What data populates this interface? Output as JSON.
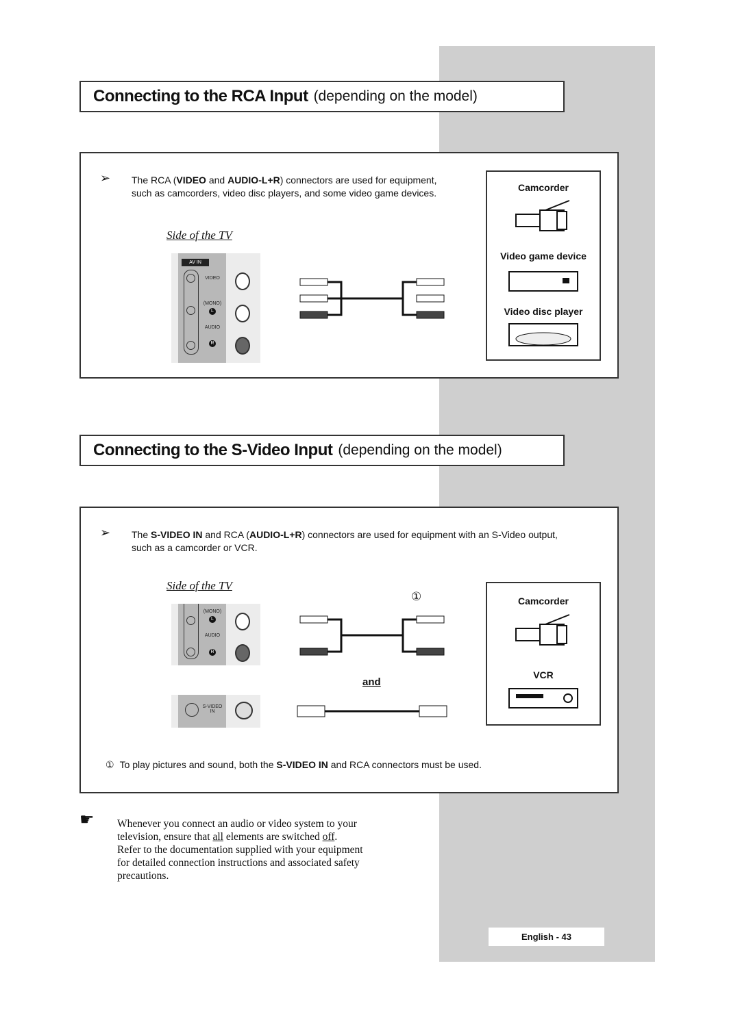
{
  "section1": {
    "title_bold": "Connecting to the RCA Input",
    "title_sub": "(depending on the model)",
    "note_line1_parts": [
      "The RCA (",
      "VIDEO",
      " and ",
      "AUDIO-L+R",
      ") connectors are used for equipment,"
    ],
    "note_line2": "such as camcorders, video disc players, and some video game devices.",
    "side_label": "Side of the TV",
    "panel": {
      "badge": "AV IN",
      "video": "VIDEO",
      "mono": "(MONO)",
      "l": "L",
      "audio": "AUDIO",
      "r": "R"
    },
    "devices": [
      "Camcorder",
      "Video game device",
      "Video disc player"
    ]
  },
  "section2": {
    "title_bold": "Connecting to the S-Video Input",
    "title_sub": "(depending on the model)",
    "note_line1_parts": [
      "The ",
      "S-VIDEO IN",
      " and RCA (",
      "AUDIO-L+R",
      ") connectors are used for equipment with an S-Video output,"
    ],
    "note_line2": "such as a camcorder or VCR.",
    "side_label": "Side of the TV",
    "panel": {
      "mono": "(MONO)",
      "l": "L",
      "audio": "AUDIO",
      "r": "R",
      "svideo": "S-VIDEO",
      "in": "IN"
    },
    "marker": "①",
    "and": "and",
    "devices": [
      "Camcorder",
      "VCR"
    ],
    "footnote_parts": [
      "①",
      "To play pictures and sound, both the ",
      "S-VIDEO IN",
      " and RCA connectors must be used."
    ]
  },
  "tip": {
    "icon": "pointing-hand-icon",
    "lines": [
      "Whenever you connect an audio or video system to your",
      "television, ensure that ",
      "all",
      " elements are switched ",
      "off",
      ".",
      "Refer to the documentation supplied with your equipment",
      "for detailed connection instructions and associated safety",
      "precautions."
    ]
  },
  "footer": {
    "page": "English - 43"
  },
  "colors": {
    "sidebar": "#cfcfcf",
    "border": "#333333"
  }
}
